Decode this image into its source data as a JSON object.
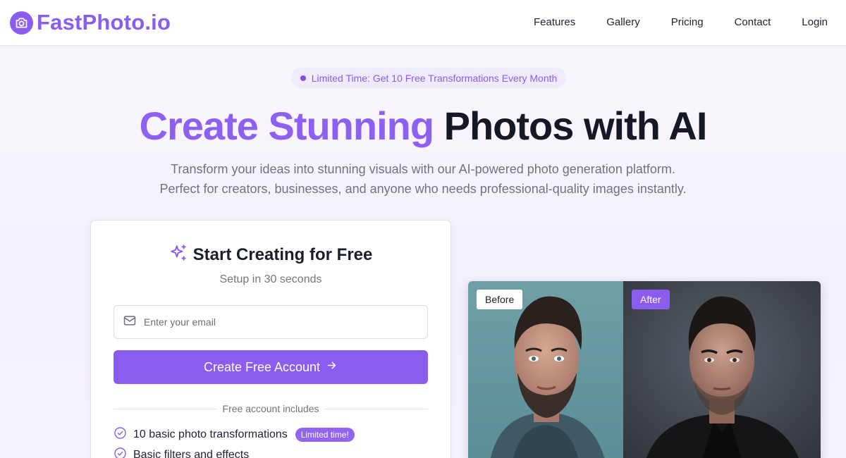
{
  "brand": {
    "name": "FastPhoto.io",
    "icon": "camera-icon",
    "color": "#8a5cf0"
  },
  "nav": {
    "links": [
      "Features",
      "Gallery",
      "Pricing",
      "Contact",
      "Login"
    ]
  },
  "hero": {
    "promo": "Limited Time: Get 10 Free Transformations Every Month",
    "title_accent": "Create Stunning",
    "title_rest": "Photos with AI",
    "subtitle_line1": "Transform your ideas into stunning visuals with our AI-powered photo generation platform.",
    "subtitle_line2": "Perfect for creators, businesses, and anyone who needs professional-quality images instantly."
  },
  "signup": {
    "icon": "sparkles-icon",
    "title": "Start Creating for Free",
    "subtitle": "Setup in 30 seconds",
    "email_placeholder": "Enter your email",
    "email_value": "",
    "cta_label": "Create Free Account",
    "divider_text": "Free account includes",
    "features": [
      {
        "text": "10 basic photo transformations",
        "badge": "Limited time!"
      },
      {
        "text": "Basic filters and effects",
        "badge": ""
      }
    ]
  },
  "compare": {
    "before_label": "Before",
    "after_label": "After"
  },
  "colors": {
    "accent": "#8a5cf0",
    "title_dark": "#151826",
    "muted": "#70727c"
  }
}
